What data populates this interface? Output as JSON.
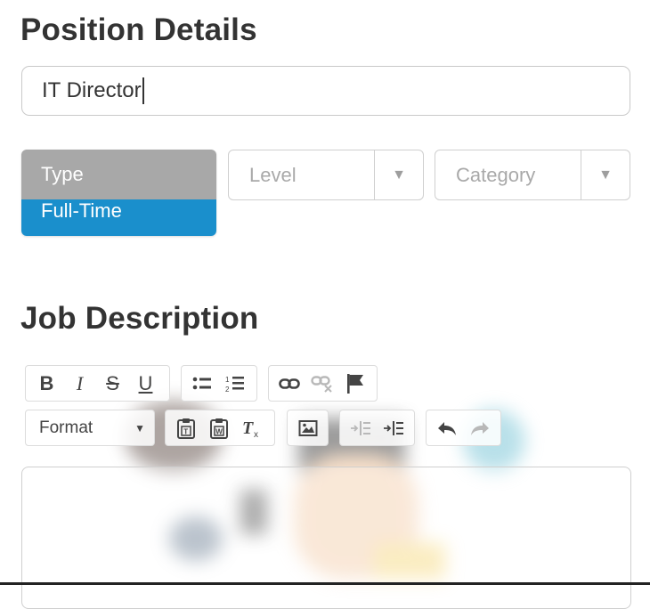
{
  "position": {
    "heading": "Position Details",
    "title_value": "IT Director"
  },
  "type_dropdown": {
    "header": "Type",
    "selected": "Full-Time"
  },
  "level_select": {
    "placeholder": "Level",
    "arrow_icon": "triangle-down-icon"
  },
  "category_select": {
    "placeholder": "Category",
    "arrow_icon": "triangle-down-icon"
  },
  "job": {
    "heading": "Job Description"
  },
  "toolbar": {
    "bold": "B",
    "italic": "I",
    "strike": "S",
    "underline": "U",
    "format_label": "Format"
  },
  "colors": {
    "selected_option": "#1a8fcc",
    "dropdown_header": "#a8a8a8"
  }
}
